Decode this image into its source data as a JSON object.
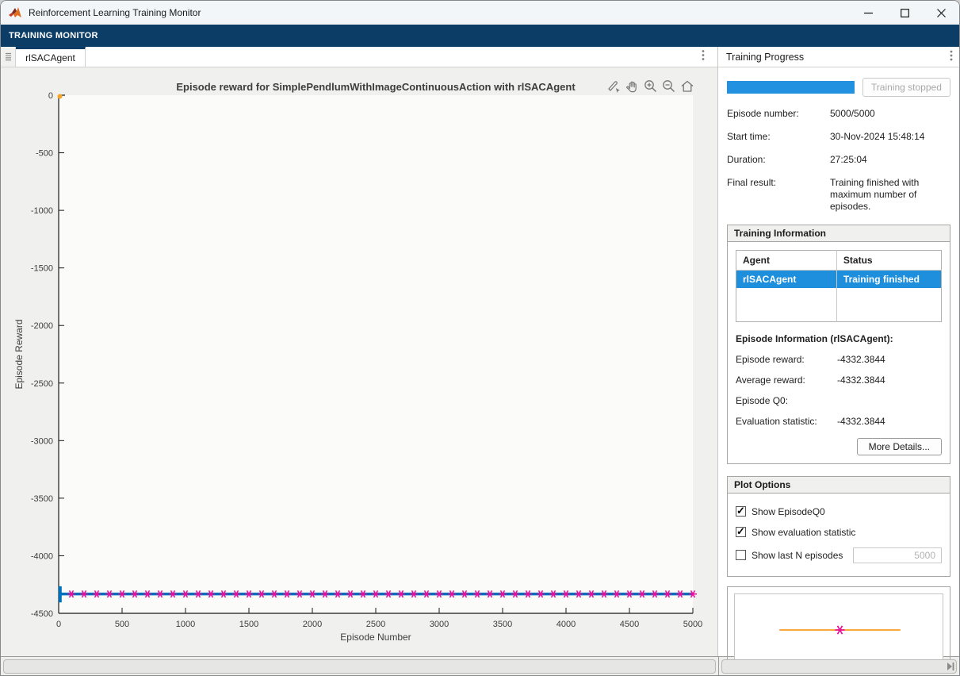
{
  "window": {
    "title": "Reinforcement Learning Training Monitor"
  },
  "ribbon": {
    "label": "TRAINING MONITOR"
  },
  "tabs": {
    "active_label": "rlSACAgent"
  },
  "icons": {
    "matlab-logo": "orange-triangle-logo",
    "minimize": "–",
    "maximize": "□",
    "close": "×",
    "kebab-menu": "⋮",
    "tab-list": "≡",
    "chart_toolbar": [
      "brush-icon",
      "pan-icon",
      "zoom-in-icon",
      "zoom-out-icon",
      "home-icon"
    ],
    "scroll-end": "skip-to-end-arrow"
  },
  "chart_data": {
    "type": "line",
    "title": "Episode reward for SimplePendlumWithImageContinuousAction with rlSACAgent",
    "xlabel": "Episode Number",
    "ylabel": "Episode Reward",
    "xlim": [
      0,
      5000
    ],
    "ylim": [
      -4500,
      0
    ],
    "xticks": [
      0,
      500,
      1000,
      1500,
      2000,
      2500,
      3000,
      3500,
      4000,
      4500,
      5000
    ],
    "yticks": [
      0,
      -500,
      -1000,
      -1500,
      -2000,
      -2500,
      -3000,
      -3500,
      -4000,
      -4500
    ],
    "grid": false,
    "plot_bg": "#fbfbf9",
    "axis_color": "#1a1a1a",
    "tick_color": "#3d3d3d",
    "series": [
      {
        "name": "EpisodeReward",
        "style": "line",
        "color": "#0072BD",
        "line_width": 3.5,
        "y_constant": -4332.3844,
        "x_range": [
          0,
          5000
        ],
        "initial_segment": {
          "x": 0,
          "y1": -4265,
          "y2": -4405
        }
      },
      {
        "name": "EvaluationStatistic",
        "style": "asterisk-markers",
        "color": "#EC0F9B",
        "x_start": 100,
        "x_step": 100,
        "x_end": 5000,
        "y": -4332.3844
      },
      {
        "name": "EpisodeQ0",
        "style": "point",
        "color": "#F6A424",
        "points": [
          [
            0,
            0
          ]
        ]
      }
    ]
  },
  "right_panel": {
    "header": "Training Progress",
    "progress": {
      "percent": 100,
      "button_label": "Training stopped"
    },
    "stats": [
      {
        "label": "Episode number:",
        "value": "5000/5000"
      },
      {
        "label": "Start time:",
        "value": "30-Nov-2024 15:48:14"
      },
      {
        "label": "Duration:",
        "value": "27:25:04"
      },
      {
        "label": "Final result:",
        "value": "Training finished with maximum number of episodes."
      }
    ],
    "training_information": {
      "header": "Training Information",
      "table": {
        "columns": [
          "Agent",
          "Status"
        ],
        "rows": [
          [
            "rlSACAgent",
            "Training finished"
          ]
        ],
        "selected_row_color": "#1e8fdd"
      },
      "episode_info_title": "Episode Information (rlSACAgent):",
      "rows": [
        {
          "label": "Episode reward:",
          "value": "-4332.3844"
        },
        {
          "label": "Average reward:",
          "value": "-4332.3844"
        },
        {
          "label": "Episode Q0:",
          "value": ""
        },
        {
          "label": "Evaluation statistic:",
          "value": "-4332.3844"
        }
      ],
      "more_details_label": "More Details..."
    },
    "plot_options": {
      "header": "Plot Options",
      "options": [
        {
          "label": "Show EpisodeQ0",
          "checked": true
        },
        {
          "label": "Show evaluation statistic",
          "checked": true
        },
        {
          "label": "Show last N episodes",
          "checked": false,
          "input_value": "5000"
        }
      ]
    },
    "preview": {
      "line_color": "#F9A83A",
      "marker_color": "#EC0F9B"
    }
  },
  "colors": {
    "ribbon_navy": "#0c3d66",
    "progress_blue": "#2191e0",
    "selection_blue": "#1e8fdd",
    "figure_bg": "#f0f0ee"
  }
}
